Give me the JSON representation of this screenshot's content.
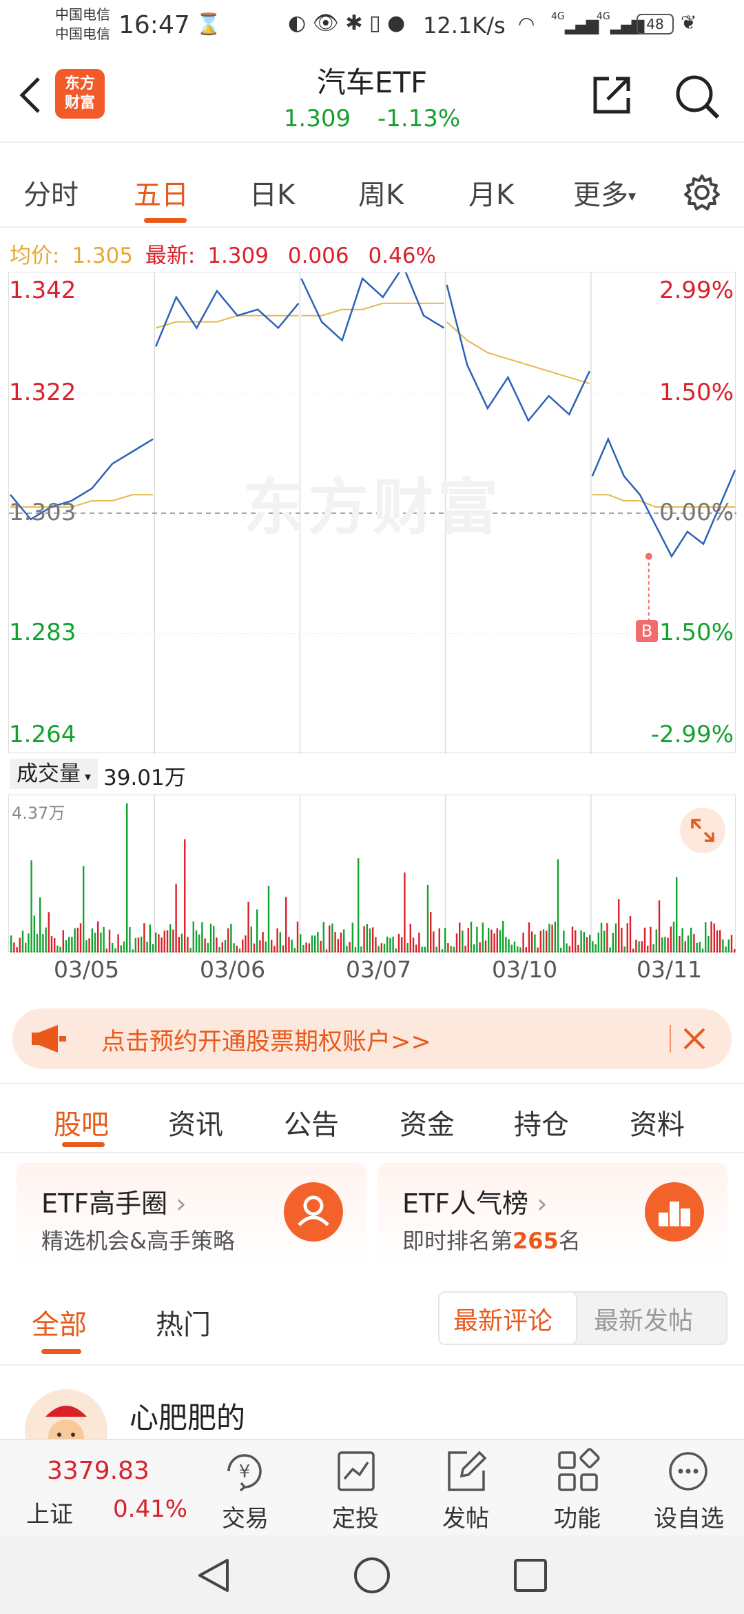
{
  "status_bar": {
    "carrier_1": "中国电信",
    "carrier_2": "中国电信",
    "time": "16:47",
    "network_speed": "12.1K/s",
    "signal_1": "4G",
    "signal_2": "4G",
    "battery": "48"
  },
  "header": {
    "logo_line1": "东方",
    "logo_line2": "财富",
    "title": "汽车ETF",
    "price": "1.309",
    "change_pct": "-1.13%"
  },
  "period_tabs": [
    "分时",
    "五日",
    "日K",
    "周K",
    "月K",
    "更多"
  ],
  "period_more_arrow": "▾",
  "active_period": "五日",
  "avg_line": {
    "avg_label": "均价:",
    "avg_value": "1.305",
    "latest_label": "最新:",
    "latest_value": "1.309",
    "diff": "0.006",
    "diff_pct": "0.46%"
  },
  "watermark": "东方财富",
  "marker_label": "B",
  "volume_header": {
    "label": "成交量",
    "arrow": "▾",
    "value": "39.01万",
    "max_label": "4.37万"
  },
  "chart_data": {
    "type": "line",
    "title": "",
    "x_dates": [
      "03/05",
      "03/06",
      "03/07",
      "03/10",
      "03/11"
    ],
    "y_left_ticks": [
      "1.342",
      "1.322",
      "1.303",
      "1.283",
      "1.264"
    ],
    "y_right_ticks": [
      "2.99%",
      "1.50%",
      "0.00%",
      "-1.50%",
      "-2.99%"
    ],
    "ylim": [
      1.264,
      1.342
    ],
    "prev_close": 1.303,
    "series": [
      {
        "role": "price",
        "color": "#2b62b8",
        "values": [
          1.306,
          1.302,
          1.304,
          1.305,
          1.307,
          1.311,
          1.313,
          1.315,
          1.33,
          1.338,
          1.333,
          1.339,
          1.335,
          1.336,
          1.333,
          1.337,
          1.341,
          1.334,
          1.331,
          1.341,
          1.338,
          1.343,
          1.335,
          1.333,
          1.34,
          1.327,
          1.32,
          1.325,
          1.318,
          1.322,
          1.319,
          1.326,
          1.309,
          1.315,
          1.309,
          1.306,
          1.301,
          1.296,
          1.3,
          1.298,
          1.304,
          1.31
        ]
      },
      {
        "role": "avg",
        "color": "#e6b84a",
        "values": [
          1.304,
          1.304,
          1.304,
          1.304,
          1.305,
          1.305,
          1.306,
          1.306,
          1.333,
          1.334,
          1.334,
          1.334,
          1.335,
          1.335,
          1.335,
          1.335,
          1.335,
          1.335,
          1.336,
          1.336,
          1.337,
          1.337,
          1.337,
          1.337,
          1.334,
          1.331,
          1.329,
          1.328,
          1.327,
          1.326,
          1.325,
          1.324,
          1.306,
          1.306,
          1.305,
          1.305,
          1.304,
          1.304,
          1.304,
          1.304,
          1.304,
          1.304
        ]
      }
    ],
    "volume_max": "4.37万"
  },
  "promo": {
    "text": "点击预约开通股票期权账户>>"
  },
  "section_tabs": [
    "股吧",
    "资讯",
    "公告",
    "资金",
    "持仓",
    "资料"
  ],
  "active_section": "股吧",
  "cards": [
    {
      "title": "ETF高手圈",
      "chevron": "›",
      "sub": "精选机会&高手策略"
    },
    {
      "title": "ETF人气榜",
      "chevron": "›",
      "sub_prefix": "即时排名第",
      "sub_num": "265",
      "sub_suffix": "名"
    }
  ],
  "filter_tabs": {
    "left": [
      "全部",
      "热门"
    ],
    "segments": [
      "最新评论",
      "最新发帖"
    ]
  },
  "post": {
    "username": "心肥肥的"
  },
  "bottom_nav": {
    "index_value": "3379.83",
    "index_name": "上证",
    "index_change": "0.41%",
    "items": [
      "交易",
      "定投",
      "发帖",
      "功能",
      "设自选"
    ],
    "trade_symbol": "¥"
  },
  "colors": {
    "accent": "#e8591a",
    "up": "#d9202b",
    "down": "#12a22e",
    "price_line": "#2b62b8",
    "avg_line": "#e6b84a"
  }
}
